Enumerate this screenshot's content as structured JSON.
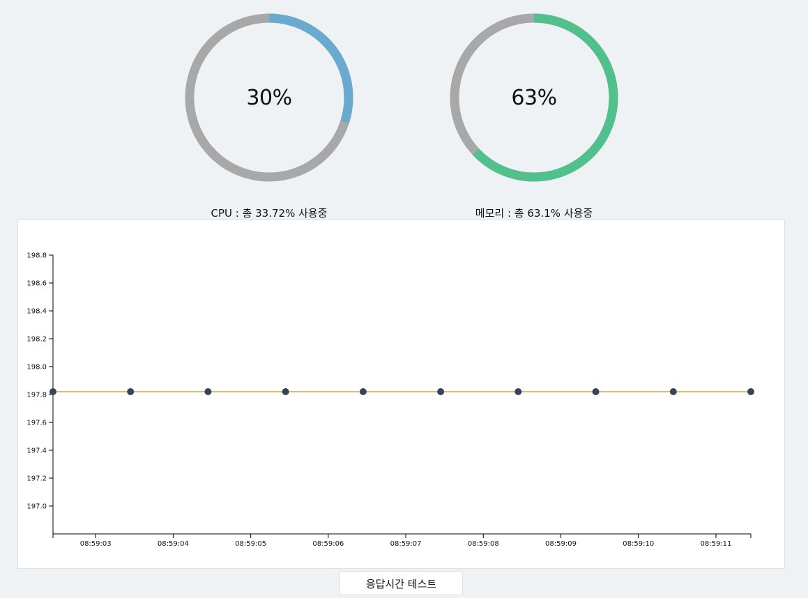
{
  "gauges": {
    "cpu": {
      "percent_label": "30%",
      "fraction": 0.3,
      "caption": "CPU : 총 33.72% 사용중",
      "color": "#6aaacf",
      "track_color": "#a8a8a8"
    },
    "memory": {
      "percent_label": "63%",
      "fraction": 0.63,
      "caption": "메모리 : 총 63.1% 사용중",
      "color": "#52c08c",
      "track_color": "#a8a8a8"
    }
  },
  "chart_data": {
    "type": "line",
    "x_ticks": [
      "08:59:03",
      "08:59:04",
      "08:59:05",
      "08:59:06",
      "08:59:07",
      "08:59:08",
      "08:59:09",
      "08:59:10",
      "08:59:11"
    ],
    "y_ticks": [
      "197.0",
      "197.2",
      "197.4",
      "197.6",
      "197.8",
      "198.0",
      "198.2",
      "198.4",
      "198.6",
      "198.8"
    ],
    "ylim": [
      196.8,
      198.8
    ],
    "xlim": [
      "08:59:02.45",
      "08:59:11.45"
    ],
    "series": [
      {
        "x": [
          "08:59:02.45",
          "08:59:03.45",
          "08:59:04.45",
          "08:59:05.45",
          "08:59:06.45",
          "08:59:07.45",
          "08:59:08.45",
          "08:59:09.45",
          "08:59:10.45",
          "08:59:11.45"
        ],
        "values": [
          197.82,
          197.82,
          197.82,
          197.82,
          197.82,
          197.82,
          197.82,
          197.82,
          197.82,
          197.82
        ],
        "line_color": "#e8a13c",
        "point_color": "#384357"
      }
    ],
    "grid": false
  },
  "button": {
    "label": "응답시간 테스트"
  }
}
